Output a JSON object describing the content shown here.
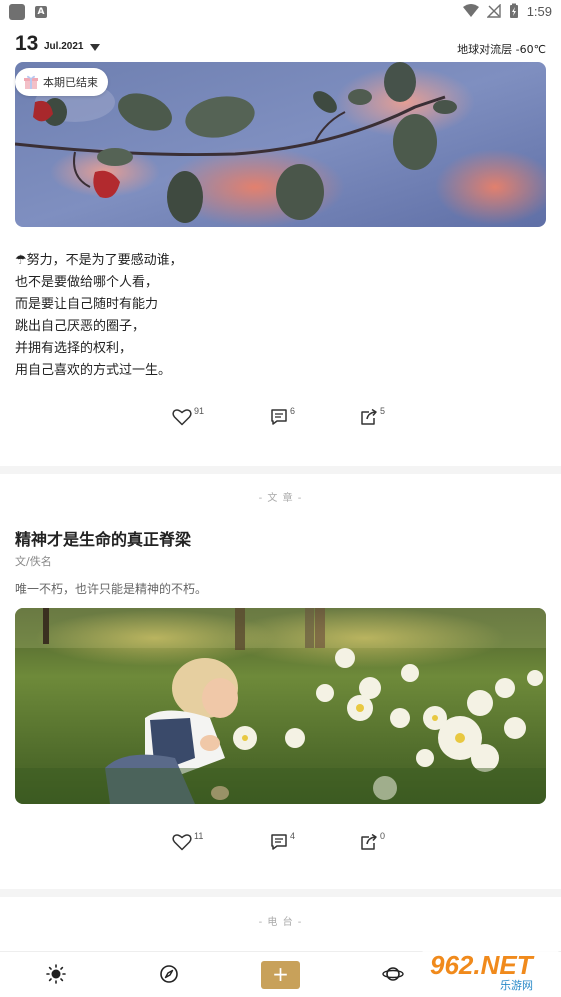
{
  "status_bar": {
    "time": "1:59",
    "icons": [
      "app-icon",
      "a-icon",
      "wifi-icon",
      "signal-icon",
      "battery-charging-icon"
    ]
  },
  "header": {
    "day": "13",
    "month_year": "Jul.2021",
    "weather": "地球对流层 -60℃"
  },
  "card1": {
    "badge": "本期已结束",
    "quote_lines": [
      "☂努力，不是为了要感动谁，",
      "也不是要做给哪个人看，",
      "而是要让自己随时有能力",
      "跳出自己厌恶的圈子，",
      "并拥有选择的权利，",
      "用自己喜欢的方式过一生。"
    ],
    "likes": "91",
    "comments": "6",
    "shares": "5"
  },
  "card2": {
    "section": "- 文 章 -",
    "title": "精神才是生命的真正脊梁",
    "author": "文/佚名",
    "excerpt": "唯一不朽，也许只能是精神的不朽。",
    "likes": "11",
    "comments": "4",
    "shares": "0"
  },
  "card3": {
    "section": "- 电 台 -"
  },
  "bottom_nav": {
    "items": [
      "sun-icon",
      "compass-icon",
      "plus-button",
      "planet-icon"
    ],
    "plus_label": "+"
  },
  "watermark": {
    "text": "962.NET",
    "sub": "乐游网"
  },
  "colors": {
    "accent": "#c8a15a",
    "page_bg": "#f4f4f4"
  }
}
